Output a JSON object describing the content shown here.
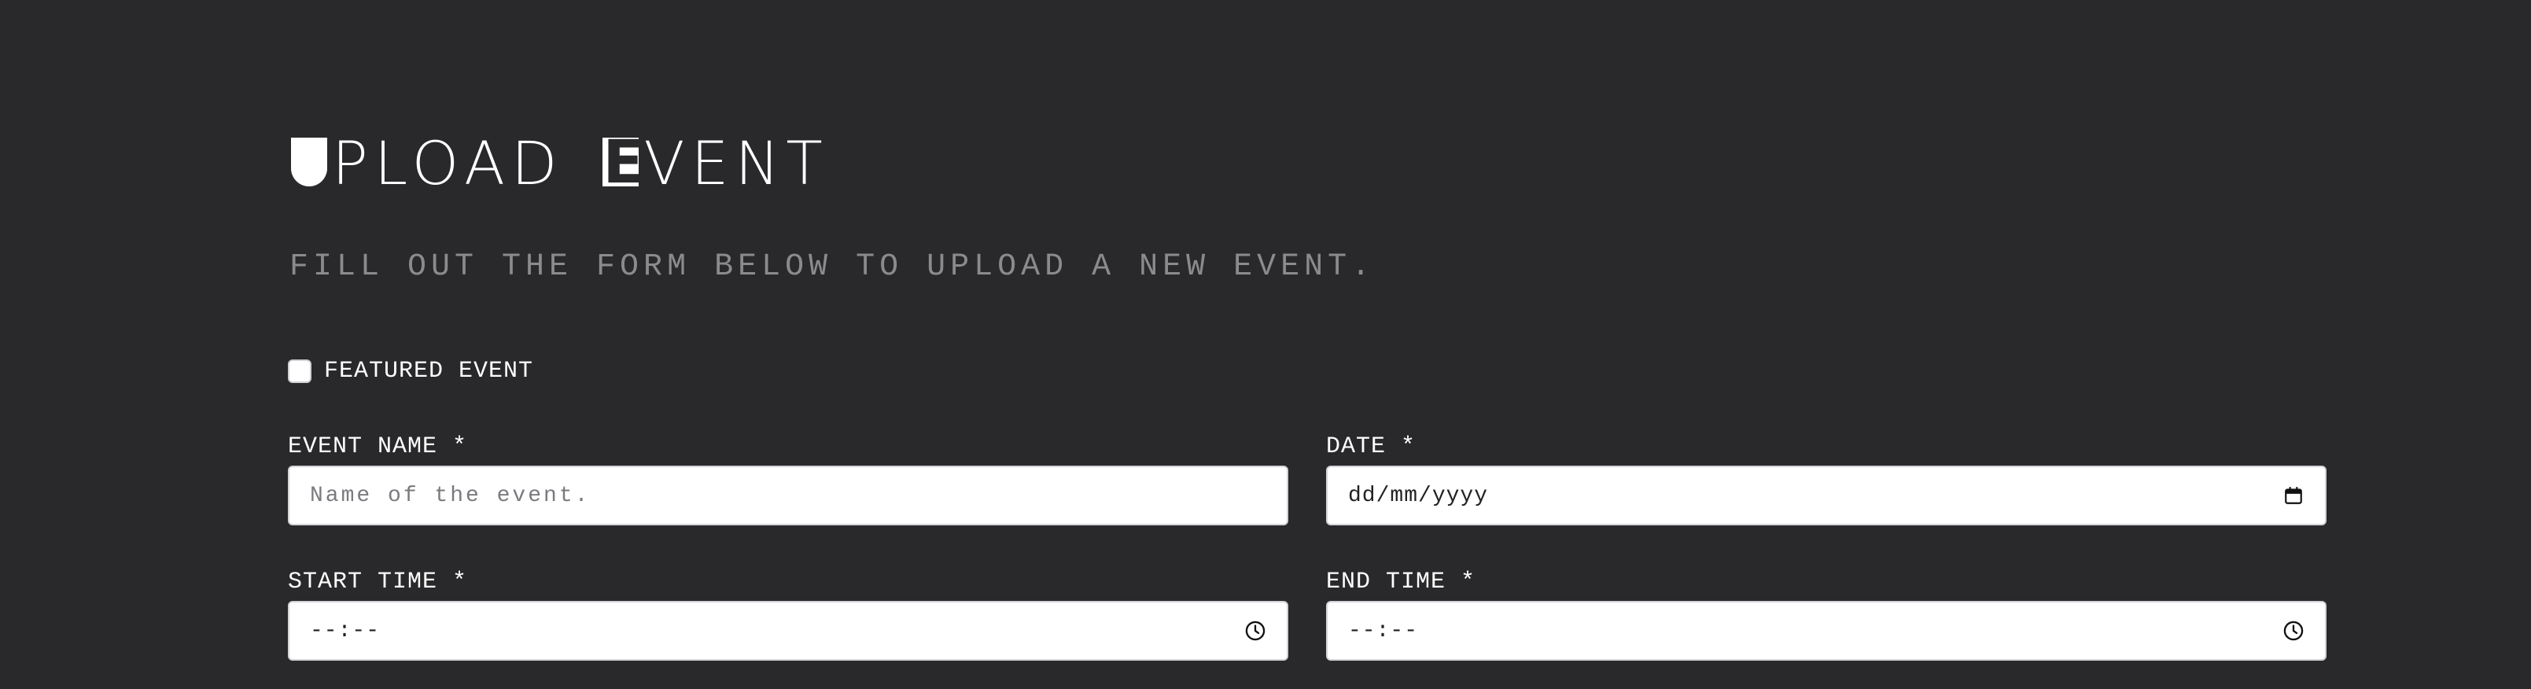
{
  "header": {
    "title_part1_first": "U",
    "title_part1_rest": "PLOAD",
    "title_part2_first": "E",
    "title_part2_rest": "VENT",
    "subtitle": "FILL OUT THE FORM BELOW TO UPLOAD A NEW EVENT."
  },
  "form": {
    "featured": {
      "label": "FEATURED EVENT",
      "checked": false
    },
    "event_name": {
      "label": "EVENT NAME *",
      "placeholder": "Name of the event.",
      "value": ""
    },
    "date": {
      "label": "DATE *",
      "value": "dd/mm/yyyy",
      "icon": "calendar-icon"
    },
    "start_time": {
      "label": "START TIME *",
      "value": "--:--",
      "icon": "clock-icon"
    },
    "end_time": {
      "label": "END TIME *",
      "value": "--:--",
      "icon": "clock-icon"
    }
  },
  "colors": {
    "background": "#29292b",
    "text": "#ffffff",
    "muted_text": "#8b8b8d",
    "input_background": "#ffffff"
  }
}
